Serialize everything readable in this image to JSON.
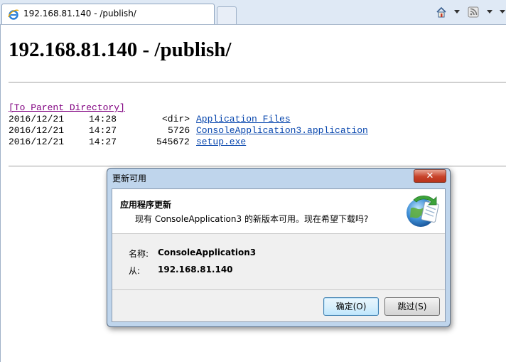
{
  "browser": {
    "tab_title": "192.168.81.140 - /publish/"
  },
  "page": {
    "title": "192.168.81.140 - /publish/",
    "parent_link": "[To Parent Directory]",
    "entries": [
      {
        "date": "2016/12/21",
        "time": "14:28",
        "size": "<dir>",
        "name": "Application Files"
      },
      {
        "date": "2016/12/21",
        "time": "14:27",
        "size": "5726",
        "name": "ConsoleApplication3.application"
      },
      {
        "date": "2016/12/21",
        "time": "14:27",
        "size": "545672",
        "name": "setup.exe"
      }
    ]
  },
  "dialog": {
    "title": "更新可用",
    "close_glyph": "✕",
    "header_title": "应用程序更新",
    "header_desc": "现有 ConsoleApplication3 的新版本可用。现在希望下载吗?",
    "name_label": "名称:",
    "name_value": "ConsoleApplication3",
    "from_label": "从:",
    "from_value": "192.168.81.140",
    "ok_label": "确定(O)",
    "skip_label": "跳过(S)"
  },
  "colors": {
    "link": "#0645ad",
    "visited_link": "#800080",
    "dialog_frame": "#bfd5ec"
  }
}
